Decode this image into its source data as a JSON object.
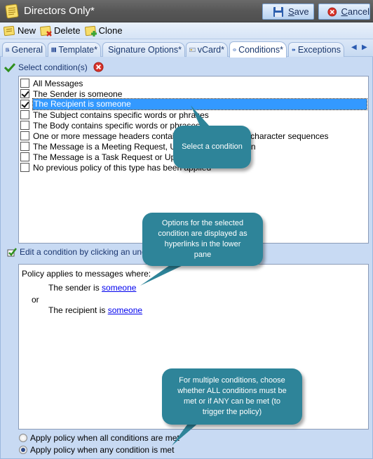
{
  "window": {
    "title": "Directors Only*",
    "save_label": "Save",
    "save_accel": "S",
    "save_rest": "ave",
    "cancel_label": "Cancel",
    "cancel_accel": "C",
    "cancel_rest": "ancel"
  },
  "toolbar": {
    "new_label": "New",
    "delete_label": "Delete",
    "clone_label": "Clone"
  },
  "tabs": [
    {
      "label": "General",
      "icon": "general-icon"
    },
    {
      "label": "Template*",
      "icon": "template-icon"
    },
    {
      "label": "Signature Options*",
      "icon": "signature-options-icon"
    },
    {
      "label": "vCard*",
      "icon": "vcard-icon"
    },
    {
      "label": "Conditions*",
      "icon": "conditions-icon",
      "active": true
    },
    {
      "label": "Exceptions",
      "icon": "exceptions-icon"
    }
  ],
  "tab_scroll": {
    "left": "◀",
    "right": "▶"
  },
  "conditions": {
    "section_label": "Select condition(s)",
    "items": [
      {
        "label": "All Messages",
        "checked": false
      },
      {
        "label": "The Sender is someone",
        "checked": true
      },
      {
        "label": "The Recipient is someone",
        "checked": true,
        "selected": true
      },
      {
        "label": "The Subject contains specific words or phrases",
        "checked": false
      },
      {
        "label": "The Body contains specific words or phrases",
        "checked": false
      },
      {
        "label": "One or more message headers contains specific words or character sequences",
        "checked": false
      },
      {
        "label": "The Message is a Meeting Request, Update or Cancellation",
        "checked": false
      },
      {
        "label": "The Message is a Task Request or Update",
        "checked": false
      },
      {
        "label": "No previous policy of this type has been applied",
        "checked": false
      }
    ]
  },
  "edit": {
    "section_label": "Edit a condition by clicking an underlined value"
  },
  "description": {
    "intro": "Policy applies to messages where:",
    "line1_prefix": "The sender is ",
    "line1_link": "someone",
    "connector": "or",
    "line2_prefix": "The recipient is ",
    "line2_link": "someone"
  },
  "apply_mode": {
    "options": [
      {
        "label": "Apply policy when all conditions are met",
        "selected": false
      },
      {
        "label": "Apply policy when any condition is met",
        "selected": true
      }
    ]
  },
  "callouts": {
    "select": "Select a condition",
    "options": "Options for the selected condition are displayed as hyperlinks in the lower pane",
    "multiple": "For multiple conditions, choose whether ALL conditions must be met or if ANY can be met (to trigger the policy)"
  },
  "colors": {
    "callout": "#2e8499",
    "selection": "#3399ff",
    "link": "#0000ee"
  }
}
